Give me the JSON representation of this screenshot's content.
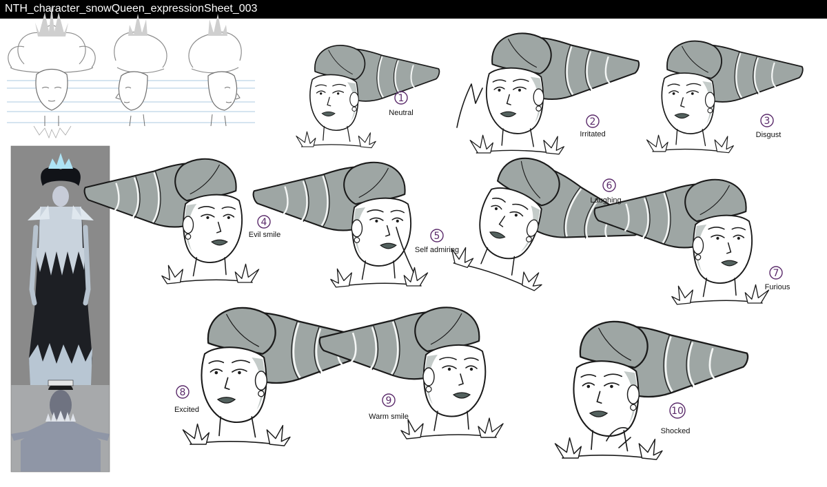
{
  "title": "NTH_character_snowQueen_expressionSheet_003",
  "expressions": [
    {
      "number": "1",
      "label": "Neutral"
    },
    {
      "number": "2",
      "label": "Irritated"
    },
    {
      "number": "3",
      "label": "Disgust"
    },
    {
      "number": "4",
      "label": "Evil smile"
    },
    {
      "number": "5",
      "label": "Self admiring"
    },
    {
      "number": "6",
      "label": "Laughing"
    },
    {
      "number": "7",
      "label": "Furious"
    },
    {
      "number": "8",
      "label": "Excited"
    },
    {
      "number": "9",
      "label": "Warm smile"
    },
    {
      "number": "10",
      "label": "Shocked"
    }
  ],
  "colors": {
    "title_bar": "#000000",
    "title_text": "#ffffff",
    "hair_tone": "#9ea6a4",
    "lip_tone": "#53615e",
    "number_ink": "#5a2a6a",
    "render_background": "#8a8a8a"
  }
}
